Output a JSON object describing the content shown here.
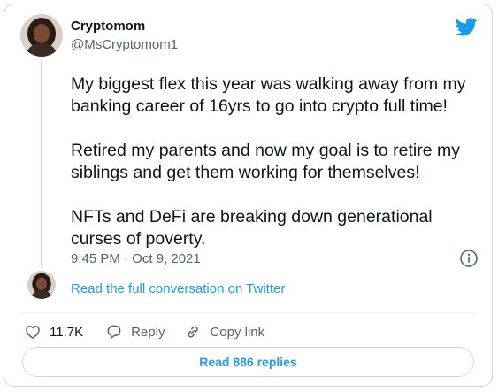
{
  "author": {
    "name": "Cryptomom",
    "handle": "@MsCryptomom1"
  },
  "tweet": {
    "paragraphs": [
      "My biggest flex this year was walking away from my banking career of 16yrs to go into crypto full time!",
      "Retired my parents and now my goal is to retire my siblings and get them working for themselves!",
      "NFTs and DeFi are breaking down generational curses of poverty."
    ],
    "timestamp": "9:45 PM · Oct 9, 2021"
  },
  "conversation_link": "Read the full conversation on Twitter",
  "actions": {
    "likes": "11.7K",
    "reply": "Reply",
    "copy_link": "Copy link"
  },
  "read_replies": "Read 886 replies",
  "colors": {
    "accent": "#1d9bf0",
    "text": "#0f1419",
    "secondary": "#536471",
    "border": "#cfd9de"
  },
  "icons": [
    "twitter-bird-icon",
    "info-icon",
    "heart-icon",
    "reply-icon",
    "link-icon"
  ]
}
